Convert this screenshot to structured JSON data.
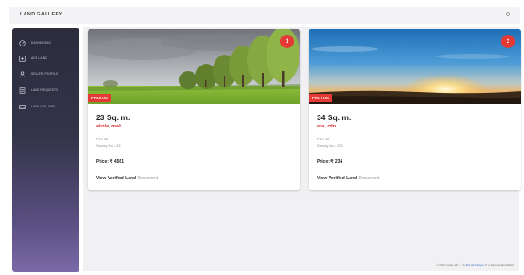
{
  "header": {
    "title": "LAND GALLERY",
    "action_icon": "settings-icon"
  },
  "sidebar": {
    "items": [
      {
        "label": "DASHBOARD",
        "icon": "dashboard-icon"
      },
      {
        "label": "ADD LAND",
        "icon": "add-land-icon"
      },
      {
        "label": "SELLER PROFILE",
        "icon": "user-icon"
      },
      {
        "label": "LAND REQUESTS",
        "icon": "list-icon"
      },
      {
        "label": "LAND GALLERY",
        "icon": "gallery-icon"
      }
    ]
  },
  "cards": [
    {
      "badge": "1",
      "tag": "PHOTOS",
      "area": "23 Sq. m.",
      "location": "akola, mah",
      "pid": "PID: 44",
      "survey": "Survey No.: 23",
      "price": "Price: ₹ 4561",
      "link_main": "View Verified Land",
      "link_sub": "Document"
    },
    {
      "badge": "2",
      "tag": "PHOTOS",
      "area": "34 Sq. m.",
      "location": "era, cdn",
      "pid": "PID: 32",
      "survey": "Survey No.: 234",
      "price": "Price: ₹ 234",
      "link_main": "View Verified Land",
      "link_sub": "Document"
    }
  ],
  "footer": {
    "prefix": "© 2021 made with ♡ by",
    "link": "Sid and Mayur",
    "suffix": "for a Decentralized Web"
  },
  "colors": {
    "accent": "#e53935",
    "sidebar_top": "#2c2c3d",
    "sidebar_bottom": "#7a6aa8",
    "background": "#f1f1f4"
  }
}
